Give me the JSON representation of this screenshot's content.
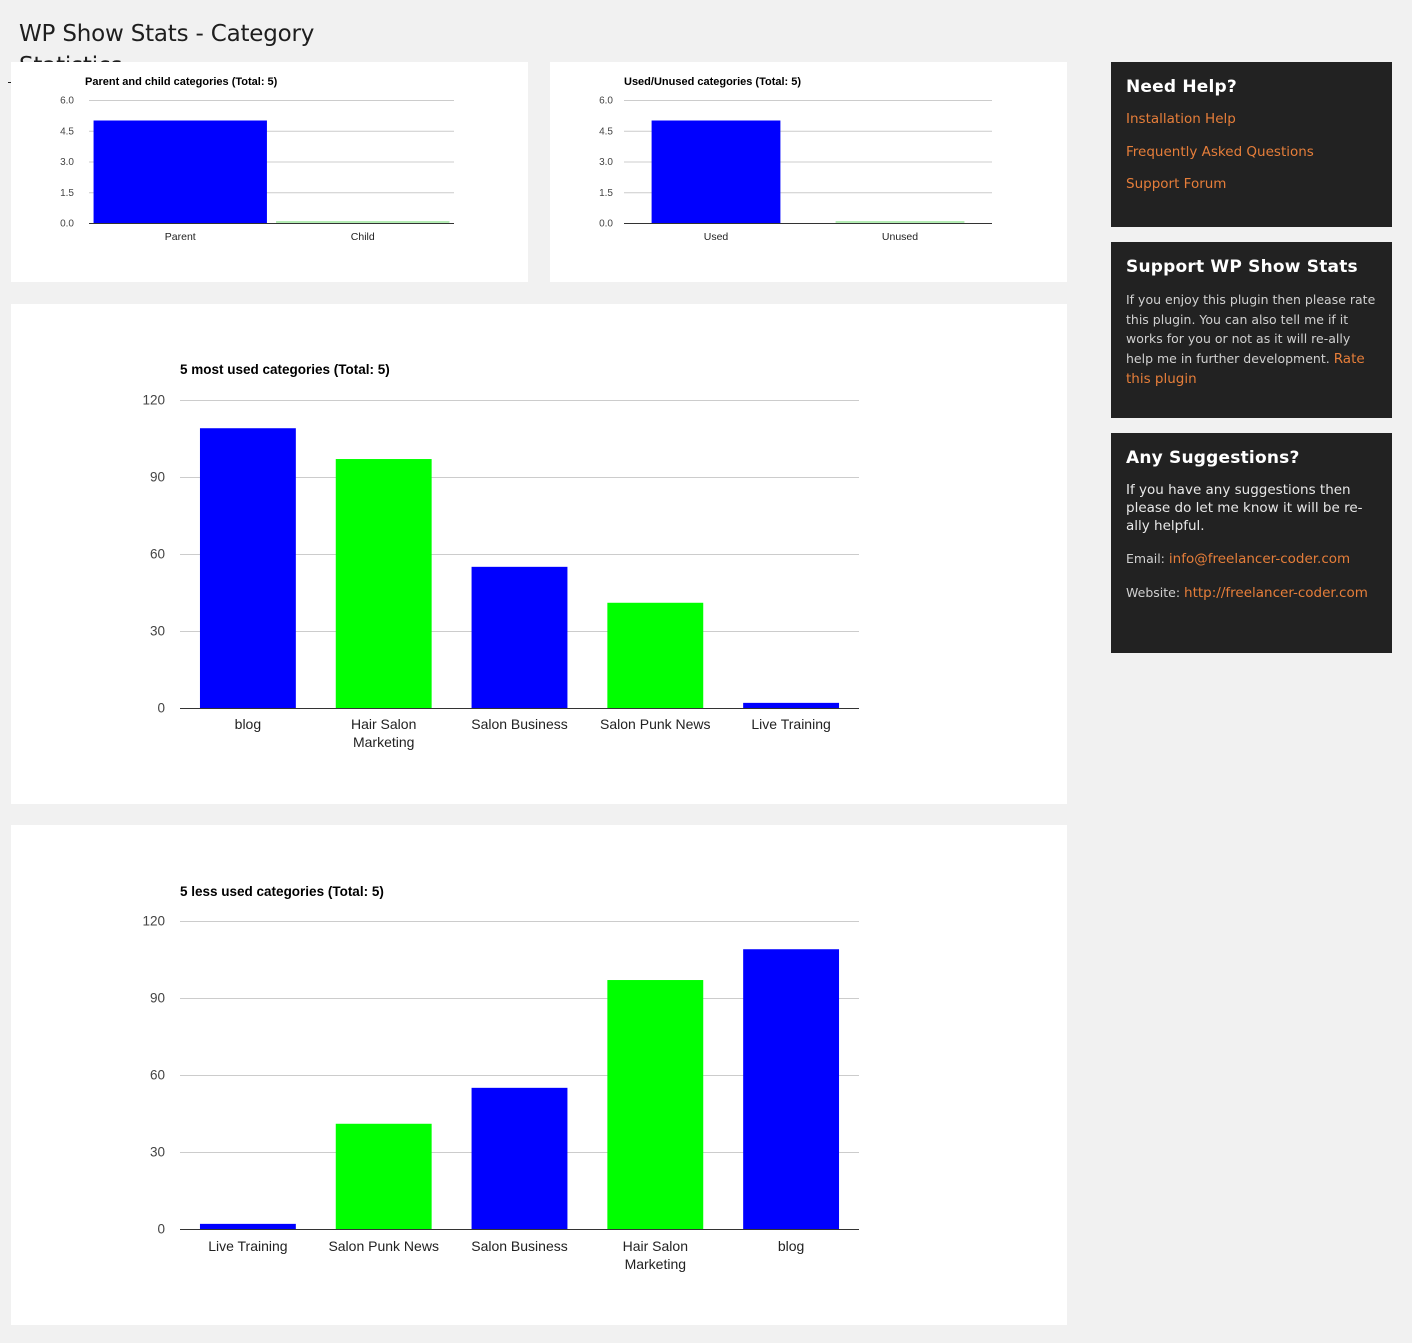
{
  "page": {
    "title": "WP Show Stats - Category Statistics"
  },
  "colors": {
    "bar_blue": "#0000ff",
    "bar_green": "#00ff00",
    "zero_bar_green": "#b4ecb4",
    "link_orange": "#e67e3a",
    "sidebar_bg": "#222222"
  },
  "sidebar": {
    "help": {
      "title": "Need Help?",
      "links": [
        "Installation Help",
        "Frequently Asked Questions",
        "Support Forum"
      ]
    },
    "support": {
      "title": "Support WP Show Stats",
      "text": "If you enjoy this plugin then please rate this plugin. You can also tell me if it works for you or not as it will re-ally help me in further development.",
      "link": "Rate this plugin"
    },
    "suggest": {
      "title": "Any Suggestions?",
      "text": "If you have any suggestions then please do let me know it will be re-ally helpful.",
      "email_label": "Email:",
      "email": "info@freelancer-coder.com",
      "website_label": "Website:",
      "website": "http://freelancer-coder.com"
    }
  },
  "chart_data": [
    {
      "id": "parent-child",
      "type": "bar",
      "title": "Parent and child categories (Total: 5)",
      "categories": [
        "Parent",
        "Child"
      ],
      "values": [
        5,
        0
      ],
      "colors": [
        "#0000ff",
        "#00ff00"
      ],
      "ylim": [
        0,
        6
      ],
      "yticks": [
        "0.0",
        "1.5",
        "3.0",
        "4.5",
        "6.0"
      ],
      "ytick_values": [
        0,
        1.5,
        3,
        4.5,
        6
      ],
      "xlabel": "",
      "ylabel": "",
      "grid": true,
      "legend": "none"
    },
    {
      "id": "used-unused",
      "type": "bar",
      "title": "Used/Unused categories (Total: 5)",
      "categories": [
        "Used",
        "Unused"
      ],
      "values": [
        5,
        0
      ],
      "colors": [
        "#0000ff",
        "#00ff00"
      ],
      "ylim": [
        0,
        6
      ],
      "yticks": [
        "0.0",
        "1.5",
        "3.0",
        "4.5",
        "6.0"
      ],
      "ytick_values": [
        0,
        1.5,
        3,
        4.5,
        6
      ],
      "xlabel": "",
      "ylabel": "",
      "grid": true,
      "legend": "none"
    },
    {
      "id": "most-used",
      "type": "bar",
      "title": "5 most used categories (Total: 5)",
      "categories": [
        [
          "blog"
        ],
        [
          "Hair Salon",
          "Marketing"
        ],
        [
          "Salon Business"
        ],
        [
          "Salon Punk News"
        ],
        [
          "Live Training"
        ]
      ],
      "values": [
        109,
        97,
        55,
        41,
        2
      ],
      "colors": [
        "#0000ff",
        "#00ff00",
        "#0000ff",
        "#00ff00",
        "#0000ff"
      ],
      "ylim": [
        0,
        120
      ],
      "yticks": [
        "0",
        "30",
        "60",
        "90",
        "120"
      ],
      "ytick_values": [
        0,
        30,
        60,
        90,
        120
      ],
      "xlabel": "",
      "ylabel": "",
      "grid": true,
      "legend": "none"
    },
    {
      "id": "less-used",
      "type": "bar",
      "title": "5 less used categories (Total: 5)",
      "categories": [
        [
          "Live Training"
        ],
        [
          "Salon Punk News"
        ],
        [
          "Salon Business"
        ],
        [
          "Hair Salon",
          "Marketing"
        ],
        [
          "blog"
        ]
      ],
      "values": [
        2,
        41,
        55,
        97,
        109
      ],
      "colors": [
        "#0000ff",
        "#00ff00",
        "#0000ff",
        "#00ff00",
        "#0000ff"
      ],
      "ylim": [
        0,
        120
      ],
      "yticks": [
        "0",
        "30",
        "60",
        "90",
        "120"
      ],
      "ytick_values": [
        0,
        30,
        60,
        90,
        120
      ],
      "xlabel": "",
      "ylabel": "",
      "grid": true,
      "legend": "none"
    }
  ]
}
